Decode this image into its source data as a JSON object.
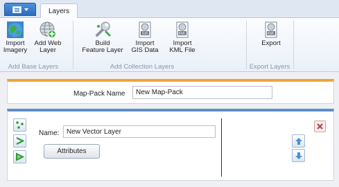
{
  "ribbon": {
    "tab_label": "Layers",
    "groups": [
      {
        "label": "Add Base Layers"
      },
      {
        "label": "Add Collection Layers"
      },
      {
        "label": "Export Layers"
      }
    ],
    "buttons": [
      {
        "label1": "Import",
        "label2": "Imagery",
        "icon": "globe-imagery-icon"
      },
      {
        "label1": "Add Web",
        "label2": "Layer",
        "icon": "web-globe-add-icon"
      },
      {
        "label1": "Build",
        "label2": "Feature Layer",
        "icon": "wrench-build-icon"
      },
      {
        "label1": "Import",
        "label2": "GIS Data",
        "icon": "gis-file-icon"
      },
      {
        "label1": "Import",
        "label2": "KML File",
        "icon": "kml-file-icon"
      },
      {
        "label1": "Export",
        "label2": "",
        "icon": "kml-export-icon"
      }
    ]
  },
  "mappack": {
    "label": "Map-Pack Name",
    "value": "New Map-Pack"
  },
  "layer": {
    "name_label": "Name:",
    "name_value": "New Vector Layer",
    "attributes_label": "Attributes"
  },
  "colors": {
    "accent_orange": "#f2a33a",
    "accent_blue": "#5d8fc9",
    "green": "#2f9a36"
  }
}
